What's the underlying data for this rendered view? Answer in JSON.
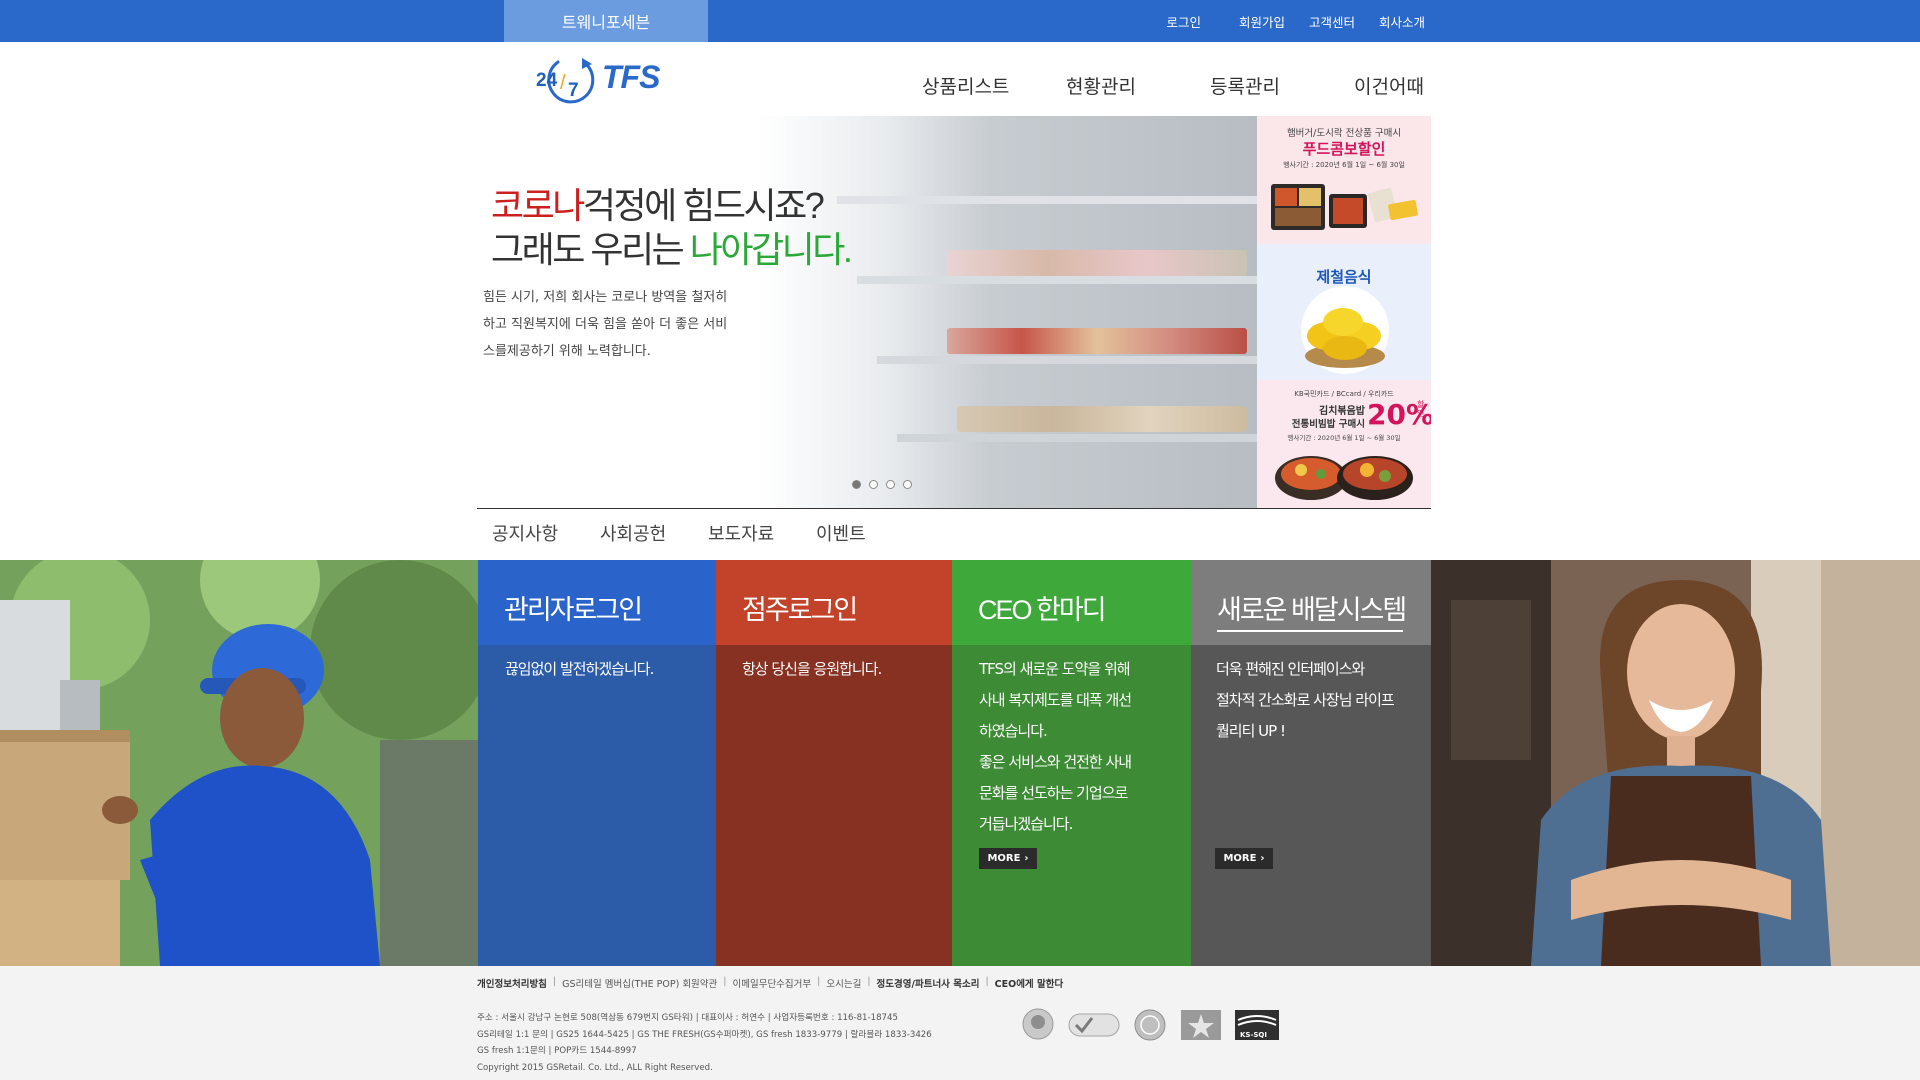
{
  "topbar": {
    "brand": "트웨니포세븐",
    "links": [
      "로그인",
      "회원가입",
      "고객센터",
      "회사소개"
    ]
  },
  "logo": {
    "numerals_left": "24",
    "numerals_right": "7",
    "name": "TFS"
  },
  "nav": [
    "상품리스트",
    "현황관리",
    "등록관리",
    "이건어때"
  ],
  "hero": {
    "title_red": "코로나",
    "title_line1_rest": "걱정에 힘드시죠?",
    "title_line2_start": "그래도 우리는 ",
    "title_green": "나아갑니다.",
    "desc_lines": [
      "힘든 시기, 저희 회사는 코로나 방역을 철저히",
      "하고 직원복지에 더욱 힘을 쏟아 더 좋은 서비",
      "스를제공하기 위해 노력합니다."
    ],
    "slides_total": 4,
    "slide_active": 1
  },
  "promos": {
    "p1": {
      "top": "햄버거/도시락 전상품 구매시",
      "headline": "푸드콤보할인",
      "period": "행사기간 : 2020년 6월 1일 ~ 6월 30일"
    },
    "p2": {
      "headline": "제철음식"
    },
    "p3": {
      "cards": "KB국민카드 / BCcard / 우리카드",
      "line1": "김치볶음밥",
      "line2": "전통비빔밥 구매시",
      "pct": "20%",
      "pct_suffix": "할인",
      "period": "행사기간 : 2020년 6월 1일 ~ 6월 30일"
    }
  },
  "tabs": [
    "공지사항",
    "사회공헌",
    "보도자료",
    "이벤트"
  ],
  "cards": [
    {
      "title": "관리자로그인",
      "body": [
        "끊임없이 발전하겠습니다."
      ]
    },
    {
      "title": "점주로그인",
      "body": [
        "항상 당신을 응원합니다."
      ]
    },
    {
      "title": "CEO 한마디",
      "body": [
        "TFS의 새로운 도약을 위해",
        "사내 복지제도를 대폭 개선",
        "하였습니다.",
        "좋은 서비스와 건전한 사내",
        "문화를 선도하는 기업으로",
        "거듭나겠습니다."
      ],
      "more": "MORE"
    },
    {
      "title": "새로운 배달시스템",
      "body": [
        "더욱 편해진 인터페이스와",
        "절차적 간소화로 사장님 라이프",
        "퀄리티 UP !"
      ],
      "more": "MORE"
    }
  ],
  "footer": {
    "links": [
      {
        "text": "개인정보처리방침",
        "bold": true
      },
      {
        "text": "GS리테일 멤버십(THE POP) 회원약관",
        "bold": false
      },
      {
        "text": "이메일무단수집거부",
        "bold": false
      },
      {
        "text": "오시는길",
        "bold": false
      },
      {
        "text": "정도경영/파트너사 목소리",
        "bold": true
      },
      {
        "text": "CEO에게 말한다",
        "bold": true
      }
    ],
    "info": [
      "주소 : 서울시 강남구 논현로 508(역삼동 679번지 GS타워) | 대표이사 : 허연수 | 사업자등록번호 : 116-81-18745",
      "GS리테일 1:1 문의 | GS25 1644-5425 | GS THE FRESH(GS수퍼마켓), GS fresh 1833-9779 | 랄라블라 1833-3426",
      "GS fresh 1:1문의 | POP카드 1544-8997",
      "Copyright 2015 GSRetail. Co. Ltd., ALL Right Reserved."
    ],
    "cert_labels": [
      "KS-SQI"
    ]
  },
  "colors": {
    "topbar": "#2a69c9",
    "admin": "#2a63c9",
    "owner": "#c2432a",
    "ceo": "#3ea93a",
    "delivery": "#7d7d7d",
    "accent_red": "#cc2020",
    "accent_green": "#2aa838"
  }
}
